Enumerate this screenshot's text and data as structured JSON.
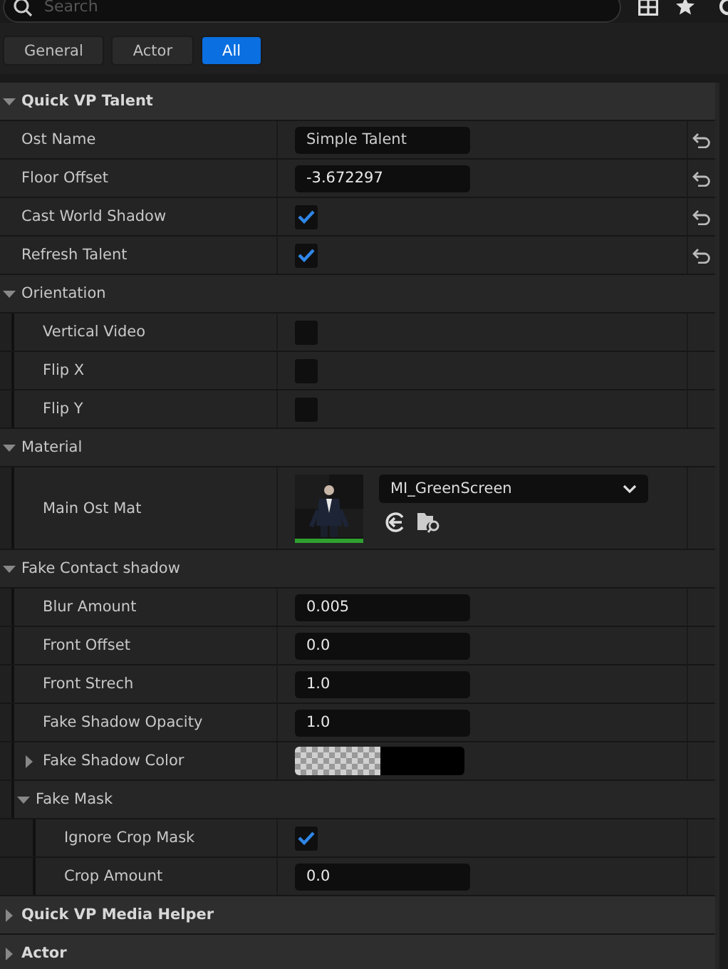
{
  "search": {
    "placeholder": "Search"
  },
  "tabs": [
    {
      "label": "General",
      "selected": false
    },
    {
      "label": "Actor",
      "selected": false
    },
    {
      "label": "All",
      "selected": true
    }
  ],
  "categories": [
    {
      "title": "Quick VP Talent",
      "expanded": true,
      "items": [
        {
          "kind": "text",
          "name": "Ost Name",
          "value": "Simple Talent",
          "reset": true
        },
        {
          "kind": "number",
          "name": "Floor Offset",
          "value": "-3.672297",
          "reset": true
        },
        {
          "kind": "checkbox",
          "name": "Cast World Shadow",
          "checked": true,
          "reset": true
        },
        {
          "kind": "checkbox",
          "name": "Refresh Talent",
          "checked": true,
          "reset": true
        },
        {
          "kind": "group",
          "name": "Orientation",
          "expanded": true,
          "children": [
            {
              "kind": "checkbox",
              "name": "Vertical Video",
              "checked": false,
              "reset": false
            },
            {
              "kind": "checkbox",
              "name": "Flip X",
              "checked": false,
              "reset": false
            },
            {
              "kind": "checkbox",
              "name": "Flip Y",
              "checked": false,
              "reset": false
            }
          ]
        },
        {
          "kind": "group",
          "name": "Material",
          "expanded": true,
          "children": [
            {
              "kind": "material",
              "name": "Main Ost Mat",
              "value": "MI_GreenScreen",
              "reset": false
            }
          ]
        },
        {
          "kind": "group",
          "name": "Fake Contact shadow",
          "expanded": true,
          "children": [
            {
              "kind": "number",
              "name": "Blur Amount",
              "value": "0.005",
              "reset": false
            },
            {
              "kind": "number",
              "name": "Front Offset",
              "value": "0.0",
              "reset": false
            },
            {
              "kind": "number",
              "name": "Front Strech",
              "value": "1.0",
              "reset": false
            },
            {
              "kind": "number",
              "name": "Fake Shadow Opacity",
              "value": "1.0",
              "reset": false
            },
            {
              "kind": "color",
              "name": "Fake Shadow Color",
              "expanded": false,
              "reset": false
            },
            {
              "kind": "group",
              "name": "Fake Mask",
              "expanded": true,
              "children": [
                {
                  "kind": "checkbox",
                  "name": "Ignore Crop Mask",
                  "checked": true,
                  "reset": false
                },
                {
                  "kind": "number",
                  "name": "Crop Amount",
                  "value": "0.0",
                  "reset": false
                }
              ]
            }
          ]
        }
      ]
    },
    {
      "title": "Quick VP Media Helper",
      "expanded": false
    },
    {
      "title": "Actor",
      "expanded": false
    }
  ]
}
